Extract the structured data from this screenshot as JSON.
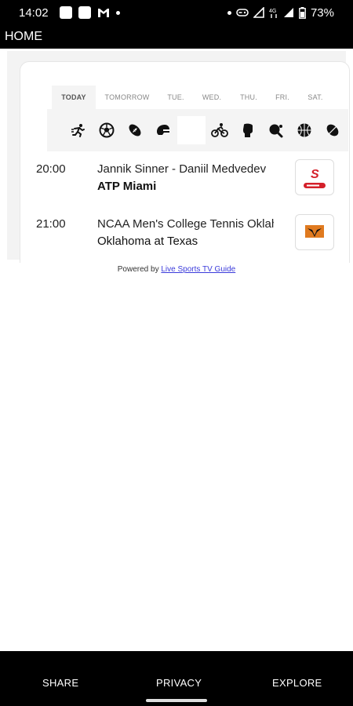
{
  "status_bar": {
    "time": "14:02",
    "battery": "73%",
    "left_icons": [
      "notification-square-icon",
      "notification-square-icon",
      "gmail-icon",
      "dot-icon"
    ],
    "right_icons": [
      "dot-icon",
      "game-controller-icon",
      "signal-icon",
      "data-4g-icon",
      "signal-icon",
      "battery-icon"
    ]
  },
  "app_bar": {
    "title": "HOME"
  },
  "day_tabs": [
    "TODAY",
    "TOMORROW",
    "TUE.",
    "WED.",
    "THU.",
    "FRI.",
    "SAT."
  ],
  "active_day": "TODAY",
  "sports": [
    {
      "icon": "running-icon"
    },
    {
      "icon": "soccer-ball-icon"
    },
    {
      "icon": "american-football-icon"
    },
    {
      "icon": "helmet-icon"
    },
    {
      "icon": "tennis-ball-icon"
    },
    {
      "icon": "cycling-icon"
    },
    {
      "icon": "boxing-glove-icon"
    },
    {
      "icon": "table-tennis-icon"
    },
    {
      "icon": "basketball-icon"
    },
    {
      "icon": "rugby-ball-icon"
    }
  ],
  "selected_sport": "tennis-ball-icon",
  "events": [
    {
      "time": "20:00",
      "title": "Jannik Sinner - Daniil Medvedev",
      "subtitle": "ATP Miami",
      "channel_logo": "supersport-tennis-logo",
      "logo_color": "#d4202a"
    },
    {
      "time": "21:00",
      "title": "NCAA Men's College Tennis Oklahoma vs Texas",
      "subtitle": "Oklahoma at Texas",
      "channel_logo": "longhorn-network-logo",
      "logo_color": "#e07a1f"
    }
  ],
  "powered": {
    "prefix": "Powered by",
    "link": "Live Sports TV Guide"
  },
  "bottom_nav": {
    "share": "SHARE",
    "privacy": "PRIVACY",
    "explore": "EXPLORE"
  },
  "colors": {
    "bar_bg": "#000000",
    "link": "#3b3bdb",
    "accent_red": "#d4202a"
  }
}
